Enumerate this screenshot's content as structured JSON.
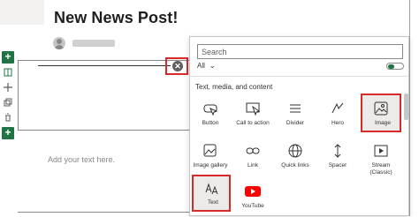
{
  "page": {
    "title": "New News Post!",
    "body_placeholder": "Add your text here."
  },
  "toolbox": {
    "search_placeholder": "Search",
    "filter_value": "All",
    "section_title": "Text, media, and content",
    "items": [
      {
        "label": "Button",
        "icon": "button-icon"
      },
      {
        "label": "Call to action",
        "icon": "call-to-action-icon"
      },
      {
        "label": "Divider",
        "icon": "divider-icon"
      },
      {
        "label": "Hero",
        "icon": "hero-icon"
      },
      {
        "label": "Image",
        "icon": "image-icon",
        "highlighted": true
      },
      {
        "label": "Image gallery",
        "icon": "image-gallery-icon"
      },
      {
        "label": "Link",
        "icon": "link-icon"
      },
      {
        "label": "Quick links",
        "icon": "quick-links-icon"
      },
      {
        "label": "Spacer",
        "icon": "spacer-icon"
      },
      {
        "label": "Stream (Classic)",
        "icon": "stream-icon"
      },
      {
        "label": "Text",
        "icon": "text-icon",
        "highlighted": true
      },
      {
        "label": "YouTube",
        "icon": "youtube-icon"
      }
    ]
  },
  "colors": {
    "accent": "#217346",
    "highlight": "#d92a2a",
    "youtube": "#ff0000"
  }
}
